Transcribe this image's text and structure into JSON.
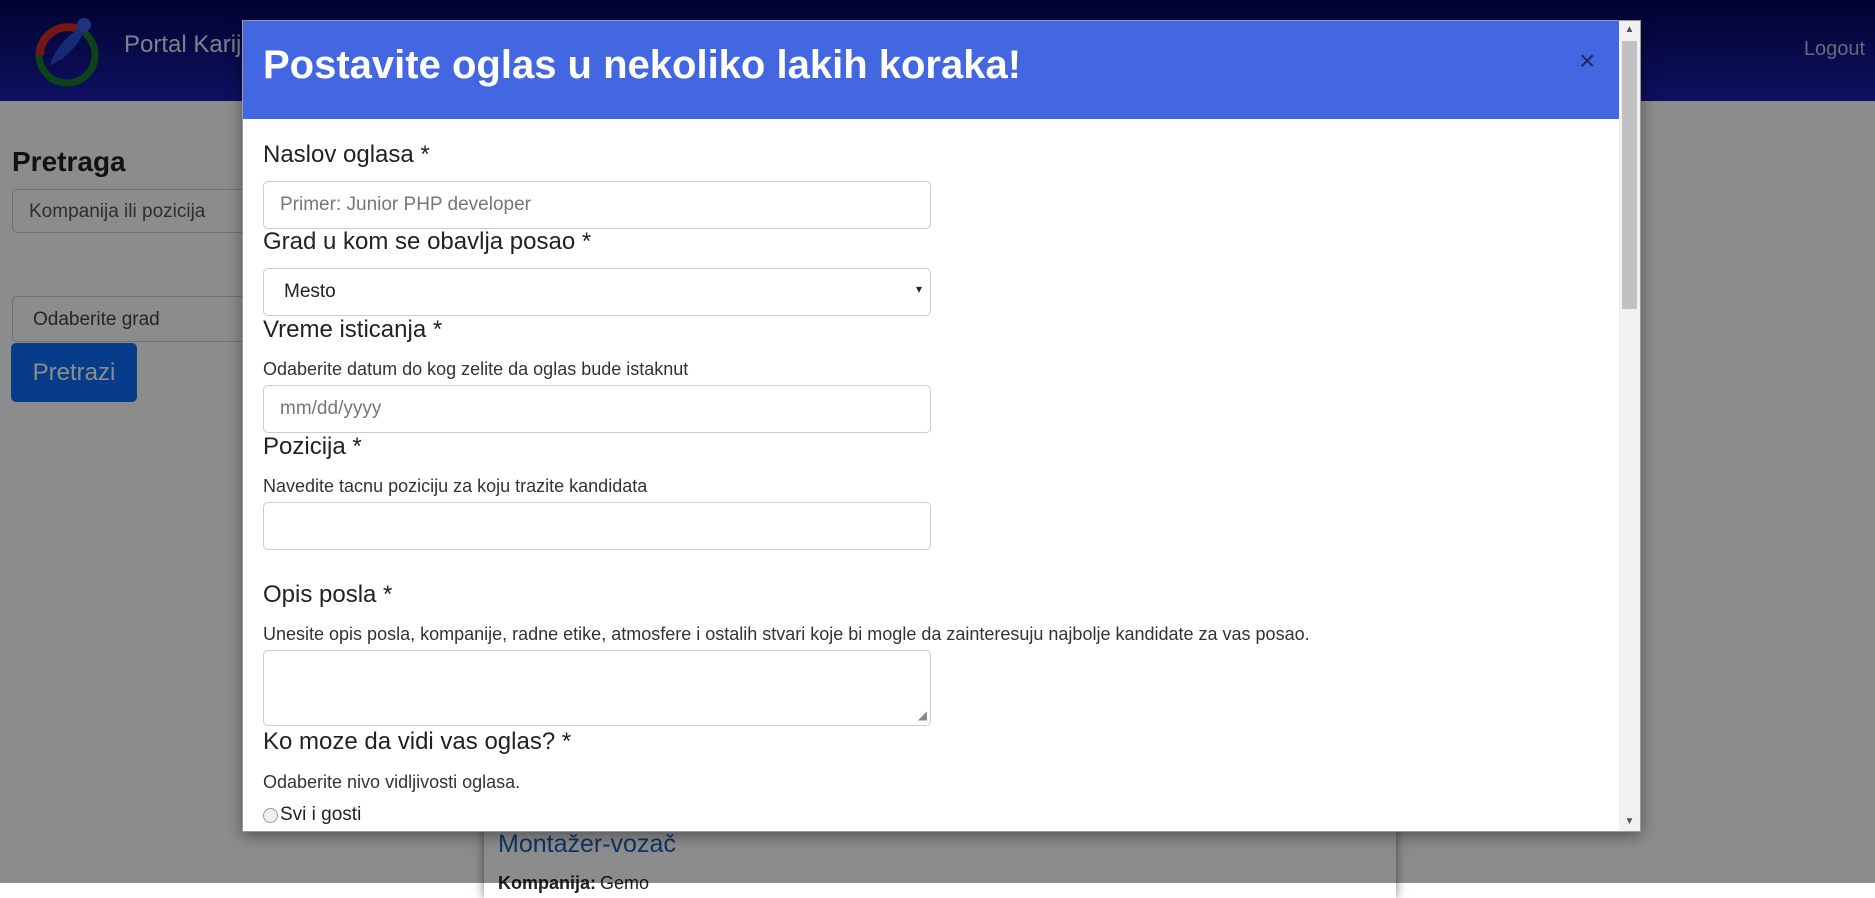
{
  "nav": {
    "brand": "Portal Karij",
    "logout": "Logout"
  },
  "sidebar": {
    "title": "Pretraga",
    "search_placeholder": "Kompanija ili pozicija",
    "city_select": "Odaberite grad",
    "search_button": "Pretrazi"
  },
  "background_card": {
    "title": "Montažer-vozač",
    "company_label": "Kompanija:",
    "company_value": "Gemo"
  },
  "modal": {
    "title": "Postavite oglas u nekoliko lakih koraka!",
    "close": "×",
    "fields": {
      "naslov": {
        "label": "Naslov oglasa *",
        "placeholder": "Primer: Junior PHP developer"
      },
      "grad": {
        "label": "Grad u kom se obavlja posao *",
        "selected": "Mesto",
        "arrow": "▾"
      },
      "vreme": {
        "label": "Vreme isticanja *",
        "help": "Odaberite datum do kog zelite da oglas bude istaknut",
        "placeholder": "mm/dd/yyyy"
      },
      "pozicija": {
        "label": "Pozicija *",
        "help": "Navedite tacnu poziciju za koju trazite kandidata",
        "value": ""
      },
      "opis": {
        "label": "Opis posla *",
        "help": "Unesite opis posla, kompanije, radne etike, atmosfere i ostalih stvari koje bi mogle da zainteresuju najbolje kandidate za vas posao.",
        "value": ""
      },
      "vidljivost": {
        "label": "Ko moze da vidi vas oglas? *",
        "help": "Odaberite nivo vidljivosti oglasa.",
        "option1": "Svi i gosti"
      }
    }
  },
  "colors": {
    "nav_top": "#03065a",
    "nav_bottom": "#1a1fb0",
    "modal_header": "#4267e0",
    "primary_button": "#0d6efd",
    "link": "#1d5fb8"
  }
}
